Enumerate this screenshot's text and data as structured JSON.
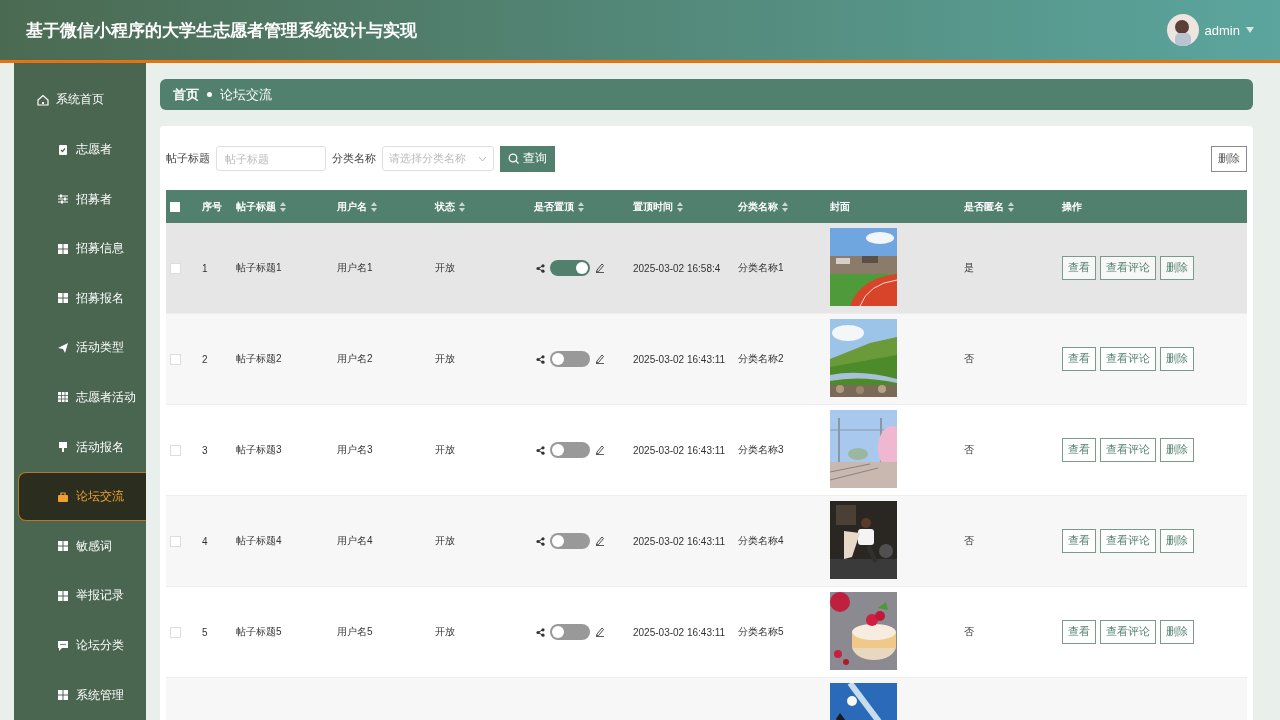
{
  "header": {
    "title": "基于微信小程序的大学生志愿者管理系统设计与实现",
    "user": "admin"
  },
  "sidebar": {
    "items": [
      {
        "label": "系统首页",
        "selected": false
      },
      {
        "label": "志愿者",
        "selected": false
      },
      {
        "label": "招募者",
        "selected": false
      },
      {
        "label": "招募信息",
        "selected": false
      },
      {
        "label": "招募报名",
        "selected": false
      },
      {
        "label": "活动类型",
        "selected": false
      },
      {
        "label": "志愿者活动",
        "selected": false
      },
      {
        "label": "活动报名",
        "selected": false
      },
      {
        "label": "论坛交流",
        "selected": true
      },
      {
        "label": "敏感词",
        "selected": false
      },
      {
        "label": "举报记录",
        "selected": false
      },
      {
        "label": "论坛分类",
        "selected": false
      },
      {
        "label": "系统管理",
        "selected": false
      }
    ]
  },
  "breadcrumb": [
    "首页",
    "论坛交流"
  ],
  "search": {
    "fields": [
      {
        "label": "帖子标题",
        "placeholder": "帖子标题",
        "kind": "text"
      },
      {
        "label": "分类名称",
        "placeholder": "请选择分类名称",
        "kind": "select"
      }
    ],
    "button": "查询",
    "delete_button": "删除"
  },
  "table": {
    "select_all_checked": false,
    "columns": [
      {
        "label": "序号",
        "sortable": false
      },
      {
        "label": "帖子标题",
        "sortable": true
      },
      {
        "label": "用户名",
        "sortable": true
      },
      {
        "label": "状态",
        "sortable": true
      },
      {
        "label": "是否置顶",
        "sortable": true
      },
      {
        "label": "置顶时间",
        "sortable": true
      },
      {
        "label": "分类名称",
        "sortable": true
      },
      {
        "label": "封面",
        "sortable": false
      },
      {
        "label": "是否匿名",
        "sortable": true
      },
      {
        "label": "操作",
        "sortable": false
      }
    ],
    "rows": [
      {
        "checked": false,
        "hovered": true,
        "index": "1",
        "title": "帖子标题1",
        "user": "用户名1",
        "status": "开放",
        "pinned": true,
        "pin_time": "2025-03-02 16:58:4",
        "category": "分类名称1",
        "cover": {
          "kind": "picture"
        },
        "anonymous": "是",
        "actions": [
          "查看",
          "查看评论",
          "删除"
        ]
      },
      {
        "checked": false,
        "hovered": false,
        "index": "2",
        "title": "帖子标题2",
        "user": "用户名2",
        "status": "开放",
        "pinned": false,
        "pin_time": "2025-03-02 16:43:11",
        "category": "分类名称2",
        "cover": {
          "kind": "picture"
        },
        "anonymous": "否",
        "actions": [
          "查看",
          "查看评论",
          "删除"
        ]
      },
      {
        "checked": false,
        "hovered": false,
        "index": "3",
        "title": "帖子标题3",
        "user": "用户名3",
        "status": "开放",
        "pinned": false,
        "pin_time": "2025-03-02 16:43:11",
        "category": "分类名称3",
        "cover": {
          "kind": "picture"
        },
        "anonymous": "否",
        "actions": [
          "查看",
          "查看评论",
          "删除"
        ]
      },
      {
        "checked": false,
        "hovered": false,
        "index": "4",
        "title": "帖子标题4",
        "user": "用户名4",
        "status": "开放",
        "pinned": false,
        "pin_time": "2025-03-02 16:43:11",
        "category": "分类名称4",
        "cover": {
          "kind": "picture"
        },
        "anonymous": "否",
        "actions": [
          "查看",
          "查看评论",
          "删除"
        ]
      },
      {
        "checked": false,
        "hovered": false,
        "index": "5",
        "title": "帖子标题5",
        "user": "用户名5",
        "status": "开放",
        "pinned": false,
        "pin_time": "2025-03-02 16:43:11",
        "category": "分类名称5",
        "cover": {
          "kind": "picture"
        },
        "anonymous": "否",
        "actions": [
          "查看",
          "查看评论",
          "删除"
        ]
      },
      {
        "cover": {
          "kind": "picture"
        }
      }
    ]
  }
}
